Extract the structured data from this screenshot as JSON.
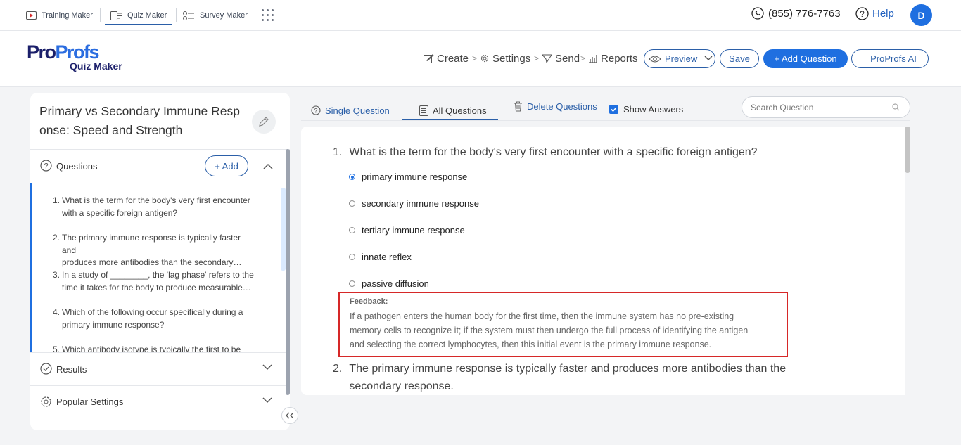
{
  "topbar": {
    "apps": [
      {
        "label": "Training Maker",
        "icon": "training-icon"
      },
      {
        "label": "Quiz Maker",
        "icon": "quiz-icon",
        "active": true
      },
      {
        "label": "Survey Maker",
        "icon": "survey-icon"
      }
    ],
    "phone": "(855) 776-7763",
    "help": "Help",
    "avatar": "D"
  },
  "logo": {
    "pro": "Pro",
    "profs": "Profs",
    "sub": "Quiz Maker"
  },
  "nav": [
    "Create",
    "Settings",
    "Send",
    "Reports"
  ],
  "actions": {
    "preview": "Preview",
    "save": "Save",
    "add_question": "+ Add Question",
    "ai": "ProProfs AI"
  },
  "quiz": {
    "title_line1": "Primary vs Secondary Immune Resp",
    "title_line2": "onse: Speed and Strength"
  },
  "sections": {
    "questions": "Questions",
    "add": "+ Add",
    "results": "Results",
    "popular": "Popular Settings"
  },
  "question_list": [
    {
      "num": "1.",
      "line1": "What is the term for the body's very first encounter",
      "line2": "with a specific foreign antigen?"
    },
    {
      "num": "2.",
      "line1": "The primary immune response is typically faster and",
      "line2": "produces more antibodies than the secondary…"
    },
    {
      "num": "3.",
      "line1": "In a study of ________, the 'lag phase' refers to the",
      "line2": "time it takes for the body to produce measurable…"
    },
    {
      "num": "4.",
      "line1": "Which of the following occur specifically during a",
      "line2": "primary immune response?"
    },
    {
      "num": "5.",
      "line1": "Which antibody isotype is typically the first to be",
      "line2": ""
    }
  ],
  "tabs": {
    "single": "Single Question",
    "all": "All Questions",
    "delete": "Delete Questions",
    "show_answers": "Show Answers"
  },
  "search": {
    "placeholder": "Search Question"
  },
  "main": {
    "q1": {
      "num": "1.",
      "text": "What is the term for the body's very first encounter with a specific foreign antigen?",
      "options": [
        "primary immune response",
        "secondary immune response",
        "tertiary immune response",
        "innate reflex",
        "passive diffusion"
      ],
      "selected": 0
    },
    "feedback": {
      "heading": "Feedback:",
      "line1": "If a pathogen enters the human body for the first time, then the immune system has no pre-existing",
      "line2": "memory cells to recognize it; if the system must then undergo the full process of identifying the antigen",
      "line3": "and selecting the correct lymphocytes, then this initial event is the primary immune response."
    },
    "q2": {
      "num": "2.",
      "line1": "The primary immune response is typically faster and produces more antibodies than the",
      "line2": "secondary response."
    }
  },
  "colors": {
    "accent": "#1f6fe0",
    "feedback_border": "#d62828"
  }
}
